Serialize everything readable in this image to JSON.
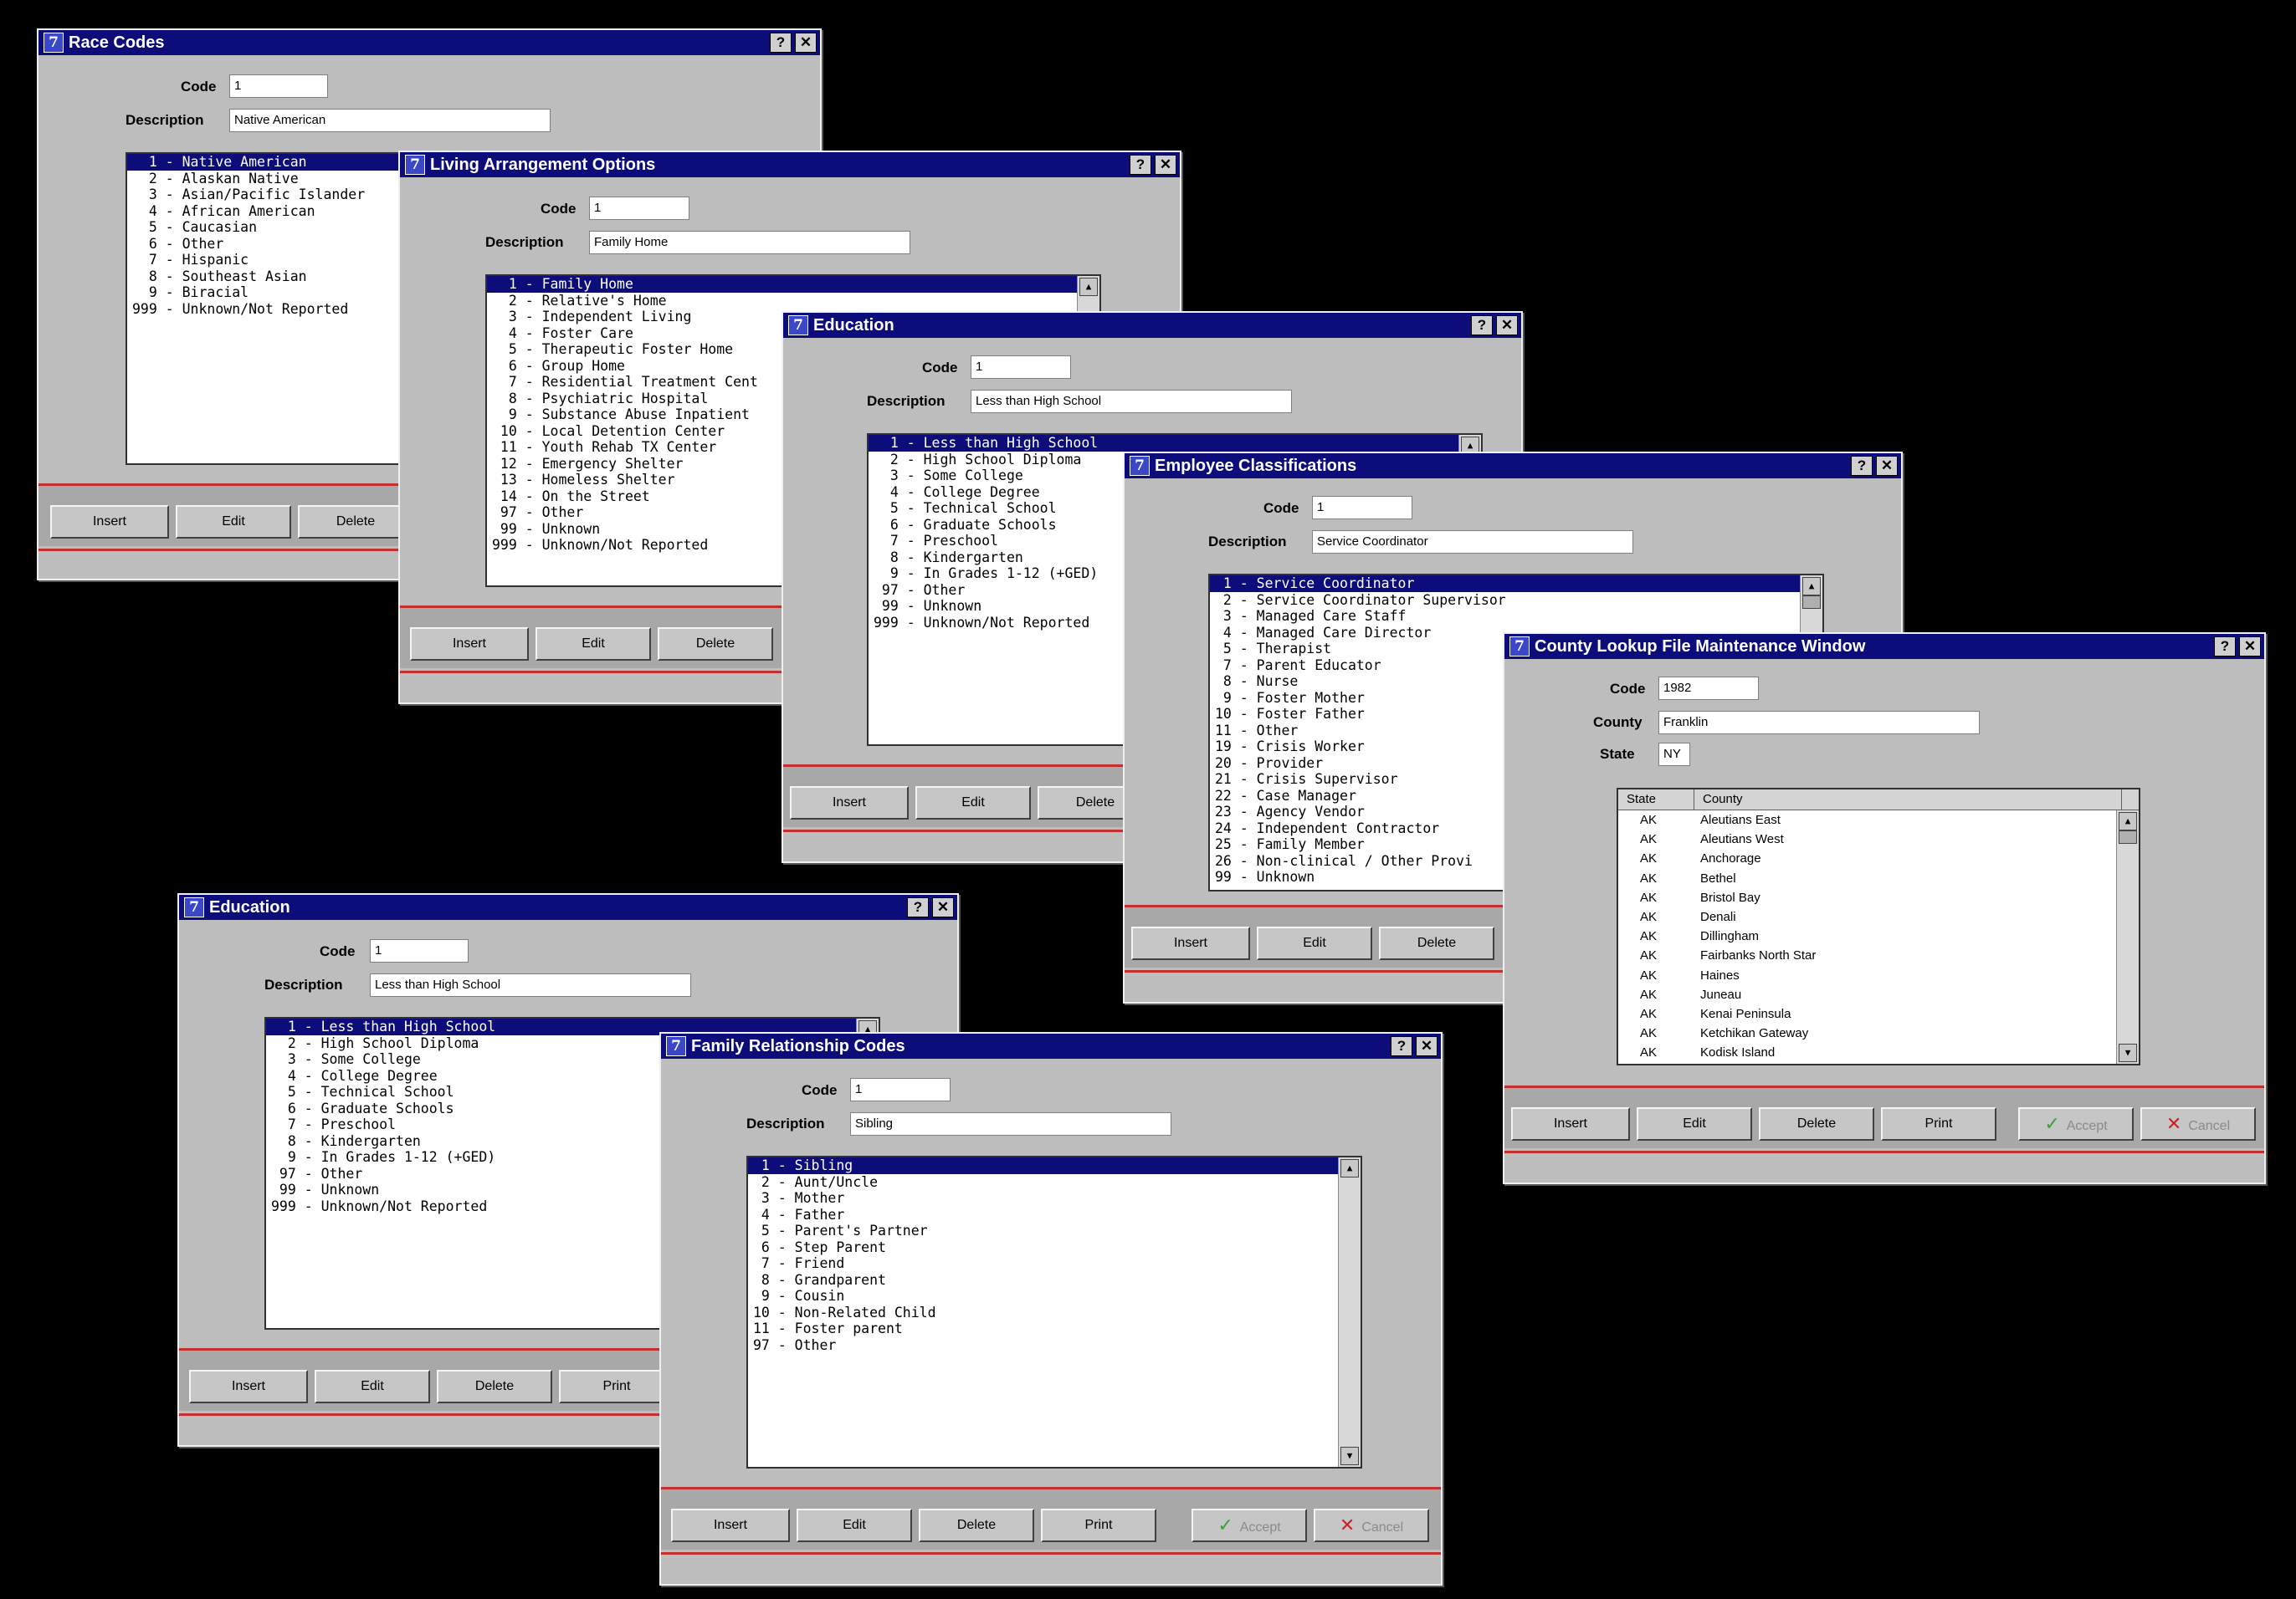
{
  "common": {
    "code_label": "Code",
    "description_label": "Description",
    "county_label": "County",
    "state_label": "State",
    "insert": "Insert",
    "edit": "Edit",
    "delete": "Delete",
    "print": "Print",
    "accept": "Accept",
    "cancel": "Cancel",
    "help_glyph": "?",
    "close_glyph": "✕",
    "app_glyph": "7"
  },
  "race": {
    "title": "Race Codes",
    "code": "1",
    "description": "Native American",
    "items": [
      "  1 - Native American",
      "  2 - Alaskan Native",
      "  3 - Asian/Pacific Islander",
      "  4 - African American",
      "  5 - Caucasian",
      "  6 - Other",
      "  7 - Hispanic",
      "  8 - Southeast Asian",
      "  9 - Biracial",
      "999 - Unknown/Not Reported"
    ]
  },
  "living": {
    "title": "Living Arrangement Options",
    "code": "1",
    "description": "Family Home",
    "items": [
      "  1 - Family Home",
      "  2 - Relative's Home",
      "  3 - Independent Living",
      "  4 - Foster Care",
      "  5 - Therapeutic Foster Home",
      "  6 - Group Home",
      "  7 - Residential Treatment Cent",
      "  8 - Psychiatric Hospital",
      "  9 - Substance Abuse Inpatient",
      " 10 - Local Detention Center",
      " 11 - Youth Rehab TX Center",
      " 12 - Emergency Shelter",
      " 13 - Homeless Shelter",
      " 14 - On the Street",
      " 97 - Other",
      " 99 - Unknown",
      "999 - Unknown/Not Reported"
    ]
  },
  "education1": {
    "title": "Education",
    "code": "1",
    "description": "Less than High School",
    "items": [
      "  1 - Less than High School",
      "  2 - High School Diploma",
      "  3 - Some College",
      "  4 - College Degree",
      "  5 - Technical School",
      "  6 - Graduate Schools",
      "  7 - Preschool",
      "  8 - Kindergarten",
      "  9 - In Grades 1-12 (+GED)",
      " 97 - Other",
      " 99 - Unknown",
      "999 - Unknown/Not Reported"
    ]
  },
  "employee": {
    "title": "Employee Classifications",
    "code": "1",
    "description": "Service Coordinator",
    "items": [
      " 1 - Service Coordinator",
      " 2 - Service Coordinator Supervisor",
      " 3 - Managed Care Staff",
      " 4 - Managed Care Director",
      " 5 - Therapist",
      " 7 - Parent Educator",
      " 8 - Nurse",
      " 9 - Foster Mother",
      "10 - Foster Father",
      "11 - Other",
      "19 - Crisis Worker",
      "20 - Provider",
      "21 - Crisis Supervisor",
      "22 - Case Manager",
      "23 - Agency Vendor",
      "24 - Independent Contractor",
      "25 - Family Member",
      "26 - Non-clinical / Other Provi",
      "99 - Unknown"
    ]
  },
  "county": {
    "title": "County Lookup File Maintenance Window",
    "code": "1982",
    "county": "Franklin",
    "state": "NY",
    "col_state": "State",
    "col_county": "County",
    "rows": [
      [
        "AK",
        "Aleutians East"
      ],
      [
        "AK",
        "Aleutians West"
      ],
      [
        "AK",
        "Anchorage"
      ],
      [
        "AK",
        "Bethel"
      ],
      [
        "AK",
        "Bristol Bay"
      ],
      [
        "AK",
        "Denali"
      ],
      [
        "AK",
        "Dillingham"
      ],
      [
        "AK",
        "Fairbanks North Star"
      ],
      [
        "AK",
        "Haines"
      ],
      [
        "AK",
        "Juneau"
      ],
      [
        "AK",
        "Kenai Peninsula"
      ],
      [
        "AK",
        "Ketchikan Gateway"
      ],
      [
        "AK",
        "Kodisk Island"
      ]
    ]
  },
  "education2": {
    "title": "Education",
    "code": "1",
    "description": "Less than High School",
    "items": [
      "  1 - Less than High School",
      "  2 - High School Diploma",
      "  3 - Some College",
      "  4 - College Degree",
      "  5 - Technical School",
      "  6 - Graduate Schools",
      "  7 - Preschool",
      "  8 - Kindergarten",
      "  9 - In Grades 1-12 (+GED)",
      " 97 - Other",
      " 99 - Unknown",
      "999 - Unknown/Not Reported"
    ]
  },
  "family": {
    "title": "Family Relationship Codes",
    "code": "1",
    "description": "Sibling",
    "items": [
      " 1 - Sibling",
      " 2 - Aunt/Uncle",
      " 3 - Mother",
      " 4 - Father",
      " 5 - Parent's Partner",
      " 6 - Step Parent",
      " 7 - Friend",
      " 8 - Grandparent",
      " 9 - Cousin",
      "10 - Non-Related Child",
      "11 - Foster parent",
      "97 - Other"
    ]
  }
}
